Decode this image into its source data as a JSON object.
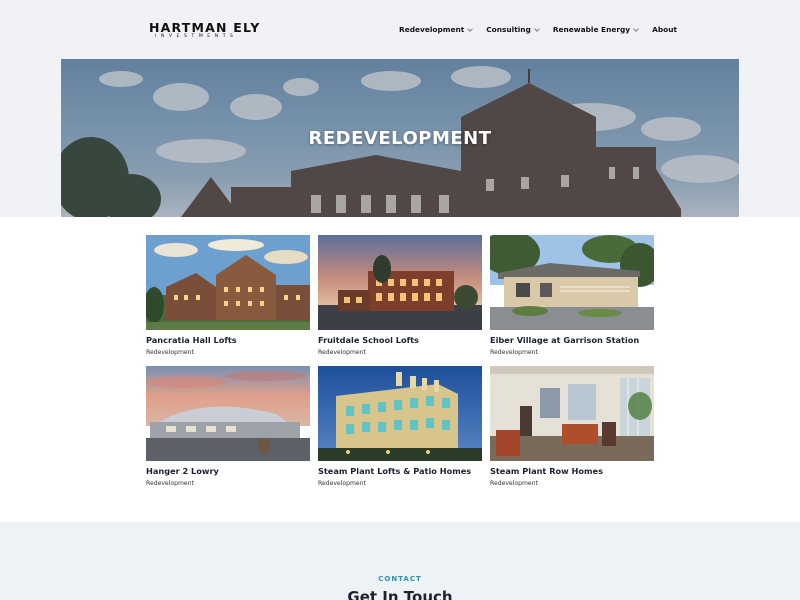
{
  "brand": {
    "name": "HARTMAN ELY",
    "sub": "INVESTMENTS"
  },
  "nav": {
    "items": [
      {
        "label": "Redevelopment",
        "has_dropdown": true
      },
      {
        "label": "Consulting",
        "has_dropdown": true
      },
      {
        "label": "Renewable Energy",
        "has_dropdown": true
      },
      {
        "label": "About",
        "has_dropdown": false
      }
    ]
  },
  "hero": {
    "title": "REDEVELOPMENT"
  },
  "projects": [
    {
      "title": "Pancratia Hall Lofts",
      "category": "Redevelopment"
    },
    {
      "title": "Fruitdale School Lofts",
      "category": "Redevelopment"
    },
    {
      "title": "Eiber Village at Garrison Station",
      "category": "Redevelopment"
    },
    {
      "title": "Hanger 2 Lowry",
      "category": "Redevelopment"
    },
    {
      "title": "Steam Plant Lofts & Patio Homes",
      "category": "Redevelopment"
    },
    {
      "title": "Steam Plant Row Homes",
      "category": "Redevelopment"
    }
  ],
  "contact": {
    "label": "CONTACT",
    "title": "Get In Touch"
  },
  "colors": {
    "accent": "#2d93ad",
    "text": "#1c2330",
    "background": "#f0f2f5"
  }
}
